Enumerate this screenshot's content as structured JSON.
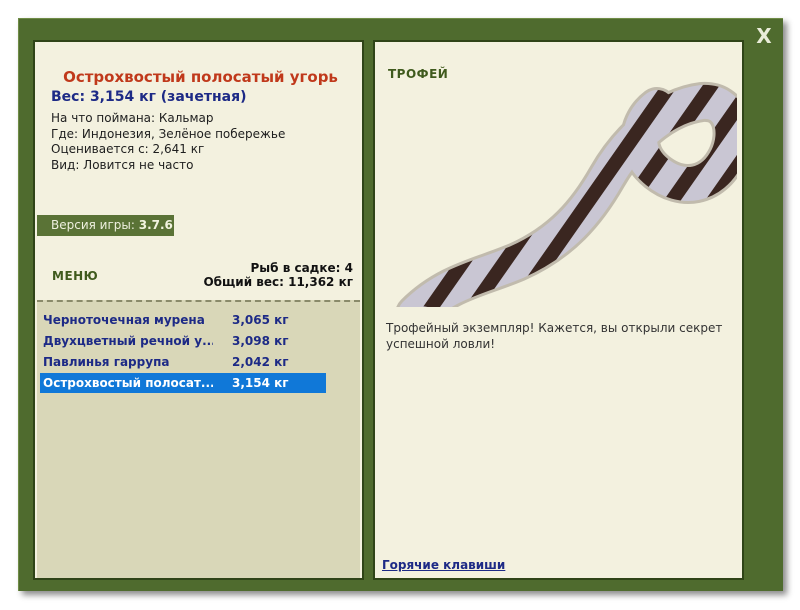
{
  "close_label": "X",
  "fish": {
    "title": "Острохвостый полосатый угорь",
    "weight_line": "Вес: 3,154 кг (зачетная)",
    "info": [
      "На что поймана: Кальмар",
      "Где: Индонезия, Зелёное побережье",
      "Оценивается с: 2,641 кг",
      "Вид: Ловится не часто"
    ]
  },
  "version": {
    "label": "Версия игры:",
    "value": "3.7.6"
  },
  "menu_label": "МЕНЮ",
  "keep": {
    "count_line": "Рыб в садке: 4",
    "total_line": "Общий вес: 11,362 кг"
  },
  "fish_list": [
    {
      "name": "Черноточечная мурена",
      "weight": "3,065 кг",
      "selected": false
    },
    {
      "name": "Двухцветный речной у...",
      "weight": "3,098 кг",
      "selected": false
    },
    {
      "name": "Павлинья гаррупа",
      "weight": "2,042 кг",
      "selected": false
    },
    {
      "name": "Острохвостый полосат...",
      "weight": "3,154 кг",
      "selected": true
    }
  ],
  "trophy": {
    "label": "ТРОФЕЙ",
    "text": "Трофейный экземпляр! Кажется, вы открыли секрет успешной ловли!",
    "image_icon": "banded-eel-illustration"
  },
  "hotkeys_label": "Горячие клавиши",
  "colors": {
    "frame": "#4f6b2e",
    "panel": "#f3f1df",
    "title_red": "#c0391b",
    "text_blue": "#1d2a86",
    "selection": "#1078d8"
  }
}
